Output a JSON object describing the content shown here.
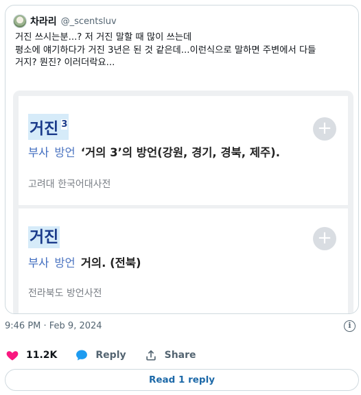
{
  "quote": {
    "author_name": "차라리",
    "author_handle": "@_scentsluv",
    "text": "거진 쓰시는분...? 저 거진 말할 때 많이 쓰는데\n평소에 얘기하다가 거진 3년은 된 것 같은데...이런식으로 말하면 주변에서 다들\n거지? 뭔진? 이러더락요..."
  },
  "dictionary_entries": [
    {
      "headword": "거진",
      "superscript": "3",
      "pos": "부사",
      "tag": "방언",
      "definition": "‘거의 3’의 방언(강원, 경기, 경북, 제주).",
      "source": "고려대 한국어대사전"
    },
    {
      "headword": "거진",
      "superscript": "",
      "pos": "부사",
      "tag": "방언",
      "definition": "거의. (전북)",
      "source": "전라북도 방언사전"
    }
  ],
  "tweet_meta": {
    "timestamp": "9:46 PM · Feb 9, 2024"
  },
  "actions": {
    "like_count": "11.2K",
    "reply_label": "Reply",
    "share_label": "Share"
  },
  "read_reply_label": "Read 1 reply",
  "colors": {
    "like": "#f91880",
    "reply": "#1d9bf0",
    "link": "#1d69a8",
    "headword": "#1a3a8a"
  }
}
